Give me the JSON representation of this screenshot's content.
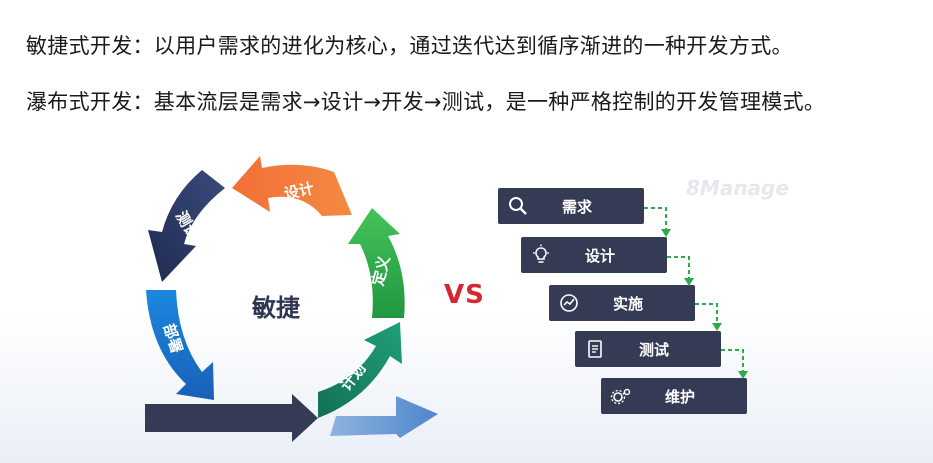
{
  "text": {
    "agile_line": "敏捷式开发：以用户需求的进化为核心，通过迭代达到循序渐进的一种开发方式。",
    "waterfall_line": "瀑布式开发：基本流层是需求→设计→开发→测试，是一种严格控制的开发管理模式。"
  },
  "agile_cycle": {
    "center": "敏捷",
    "stages": {
      "design": "设计",
      "define": "定义",
      "plan": "计划",
      "test": "测试",
      "deploy": "部署"
    },
    "colors": {
      "design": "#f26f36",
      "define": "#2eaa4a",
      "plan": "#1b8a6b",
      "test": "#2e3f6e",
      "deploy": "#1f78d1",
      "base": "#353a55",
      "out": "#5b93d1"
    }
  },
  "vs": "VS",
  "watermark": "8Manage",
  "waterfall": {
    "steps": [
      {
        "label": "需求",
        "icon": "search-icon"
      },
      {
        "label": "设计",
        "icon": "lightbulb-icon"
      },
      {
        "label": "实施",
        "icon": "gauge-icon"
      },
      {
        "label": "测试",
        "icon": "document-icon"
      },
      {
        "label": "维护",
        "icon": "gears-icon"
      }
    ],
    "connector_color": "#2eaa4a",
    "step_color": "#353a55"
  }
}
